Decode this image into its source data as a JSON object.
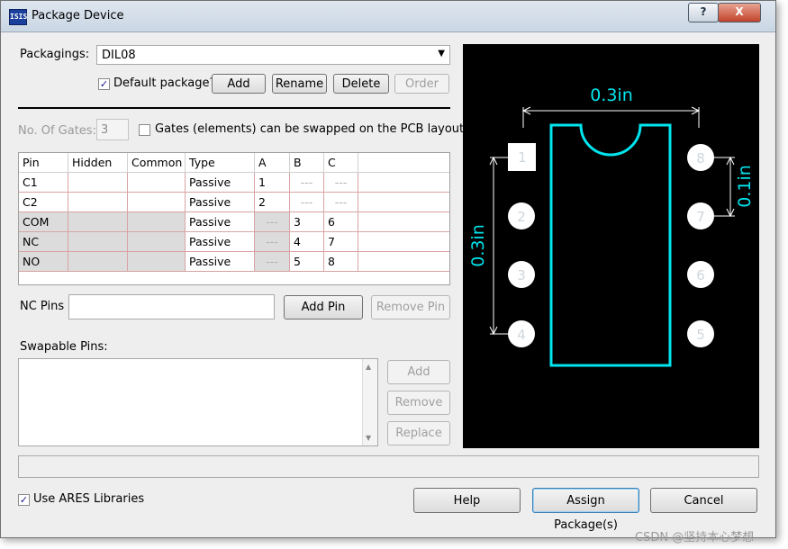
{
  "window": {
    "title": "Package Device",
    "icon_text": "ISIS",
    "help_label": "?",
    "close_label": "X"
  },
  "packagings": {
    "label": "Packagings:",
    "selected": "DIL08",
    "default_label": "Default package?",
    "default_checked": true
  },
  "buttons": {
    "add": "Add",
    "rename": "Rename",
    "delete": "Delete",
    "order": "Order",
    "add_pin": "Add Pin",
    "remove_pin": "Remove Pin",
    "swap_add": "Add",
    "swap_remove": "Remove",
    "swap_replace": "Replace",
    "help": "Help",
    "assign": "Assign Package(s)",
    "cancel": "Cancel"
  },
  "gates": {
    "label": "No. Of Gates:",
    "value": "3",
    "swap_label": "Gates (elements) can be swapped on the PCB layout?"
  },
  "pin_table": {
    "headers": [
      "Pin",
      "Hidden",
      "Common",
      "Type",
      "A",
      "B",
      "C"
    ],
    "rows": [
      [
        "C1",
        "",
        "",
        "Passive",
        "1",
        "---",
        "---"
      ],
      [
        "C2",
        "",
        "",
        "Passive",
        "2",
        "---",
        "---"
      ],
      [
        "COM",
        "",
        "",
        "Passive",
        "---",
        "3",
        "6"
      ],
      [
        "NC",
        "",
        "",
        "Passive",
        "---",
        "4",
        "7"
      ],
      [
        "NO",
        "",
        "",
        "Passive",
        "---",
        "5",
        "8"
      ]
    ]
  },
  "nc_pins": {
    "label": "NC Pins",
    "value": ""
  },
  "swapable": {
    "label": "Swapable Pins:"
  },
  "ares": {
    "label": "Use ARES Libraries",
    "checked": true
  },
  "preview": {
    "dim_width": "0.3in",
    "dim_height": "0.3in",
    "dim_pitch": "0.1in",
    "left_pins": [
      "1",
      "2",
      "3",
      "4"
    ],
    "right_pins": [
      "8",
      "7",
      "6",
      "5"
    ],
    "outline_color": "#00e5ee",
    "background": "#000000"
  },
  "watermark": "CSDN @坚持本心梦想"
}
